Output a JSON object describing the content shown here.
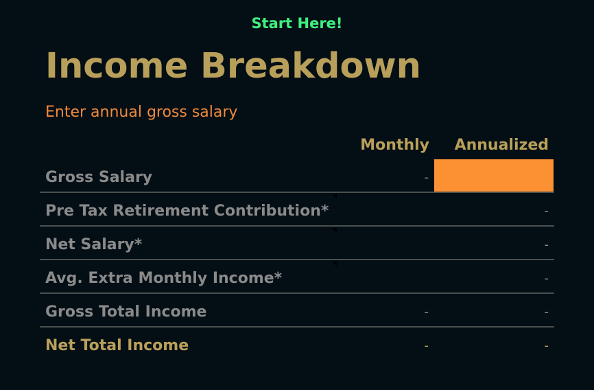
{
  "header": {
    "start_here": "Start Here!",
    "title": "Income Breakdown",
    "instruction": "Enter annual gross salary"
  },
  "columns": {
    "monthly": "Monthly",
    "annualized": "Annualized"
  },
  "input": {
    "gross_salary_value": ""
  },
  "rows": [
    {
      "label": "Gross Salary",
      "monthly": "-",
      "annualized": ""
    },
    {
      "label": "Pre Tax Retirement Contribution*",
      "monthly": "",
      "annualized": "-"
    },
    {
      "label": "Net Salary*",
      "monthly": "",
      "annualized": "-"
    },
    {
      "label": "Avg. Extra Monthly Income*",
      "monthly": "",
      "annualized": "-"
    },
    {
      "label": "Gross Total Income",
      "monthly": "-",
      "annualized": "-"
    },
    {
      "label": "Net Total Income",
      "monthly": "-",
      "annualized": "-"
    }
  ],
  "colors": {
    "background": "#040e15",
    "accent_gold": "#b9a05a",
    "accent_orange": "#f08a3c",
    "input_fill": "#fb9132",
    "start_green": "#3ff07f"
  }
}
